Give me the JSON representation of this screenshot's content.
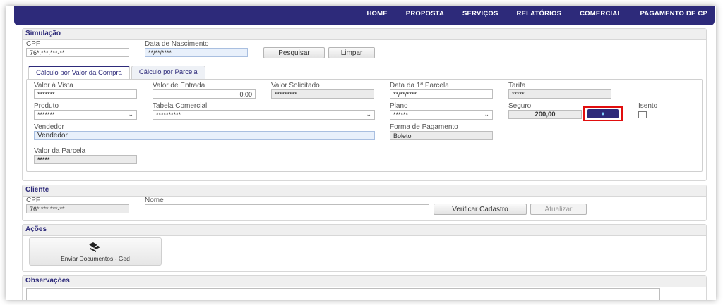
{
  "nav": {
    "items": [
      "HOME",
      "PROPOSTA",
      "SERVIÇOS",
      "RELATÓRIOS",
      "COMERCIAL",
      "PAGAMENTO DE CP"
    ]
  },
  "simulacao": {
    "title": "Simulação",
    "cpf_label": "CPF",
    "cpf_value": "76*.***.***-**",
    "nasc_label": "Data de Nascimento",
    "nasc_value": "**/**/****",
    "pesquisar": "Pesquisar",
    "limpar": "Limpar",
    "tabs": [
      "Cálculo por Valor da Compra",
      "Cálculo por Parcela"
    ],
    "valor_vista_label": "Valor à Vista",
    "valor_vista_value": "*******",
    "valor_entrada_label": "Valor de Entrada",
    "valor_entrada_value": "0,00",
    "valor_solicitado_label": "Valor Solicitado",
    "valor_solicitado_value": "*********",
    "data_parcela_label": "Data da 1ª Parcela",
    "data_parcela_value": "**/**/****",
    "tarifa_label": "Tarifa",
    "tarifa_value": "*****",
    "produto_label": "Produto",
    "produto_value": "*******",
    "tabela_label": "Tabela Comercial",
    "tabela_value": "**********",
    "plano_label": "Plano",
    "plano_value": "******",
    "seguro_label": "Seguro",
    "seguro_value": "200,00",
    "isento_label": "Isento",
    "vendedor_label": "Vendedor",
    "vendedor_value": "Vendedor",
    "forma_label": "Forma de Pagamento",
    "forma_value": "Boleto",
    "parcela_label": "Valor da Parcela",
    "parcela_value": "*****"
  },
  "cliente": {
    "title": "Cliente",
    "cpf_label": "CPF",
    "cpf_value": "76*.***.***-**",
    "nome_label": "Nome",
    "nome_value": "",
    "verificar": "Verificar Cadastro",
    "atualizar": "Atualizar"
  },
  "acoes": {
    "title": "Ações",
    "enviar": "Enviar Documentos - Ged"
  },
  "observacoes": {
    "title": "Observações"
  },
  "colors": {
    "navy": "#2d2a7a",
    "highlight": "#e10e0e"
  }
}
